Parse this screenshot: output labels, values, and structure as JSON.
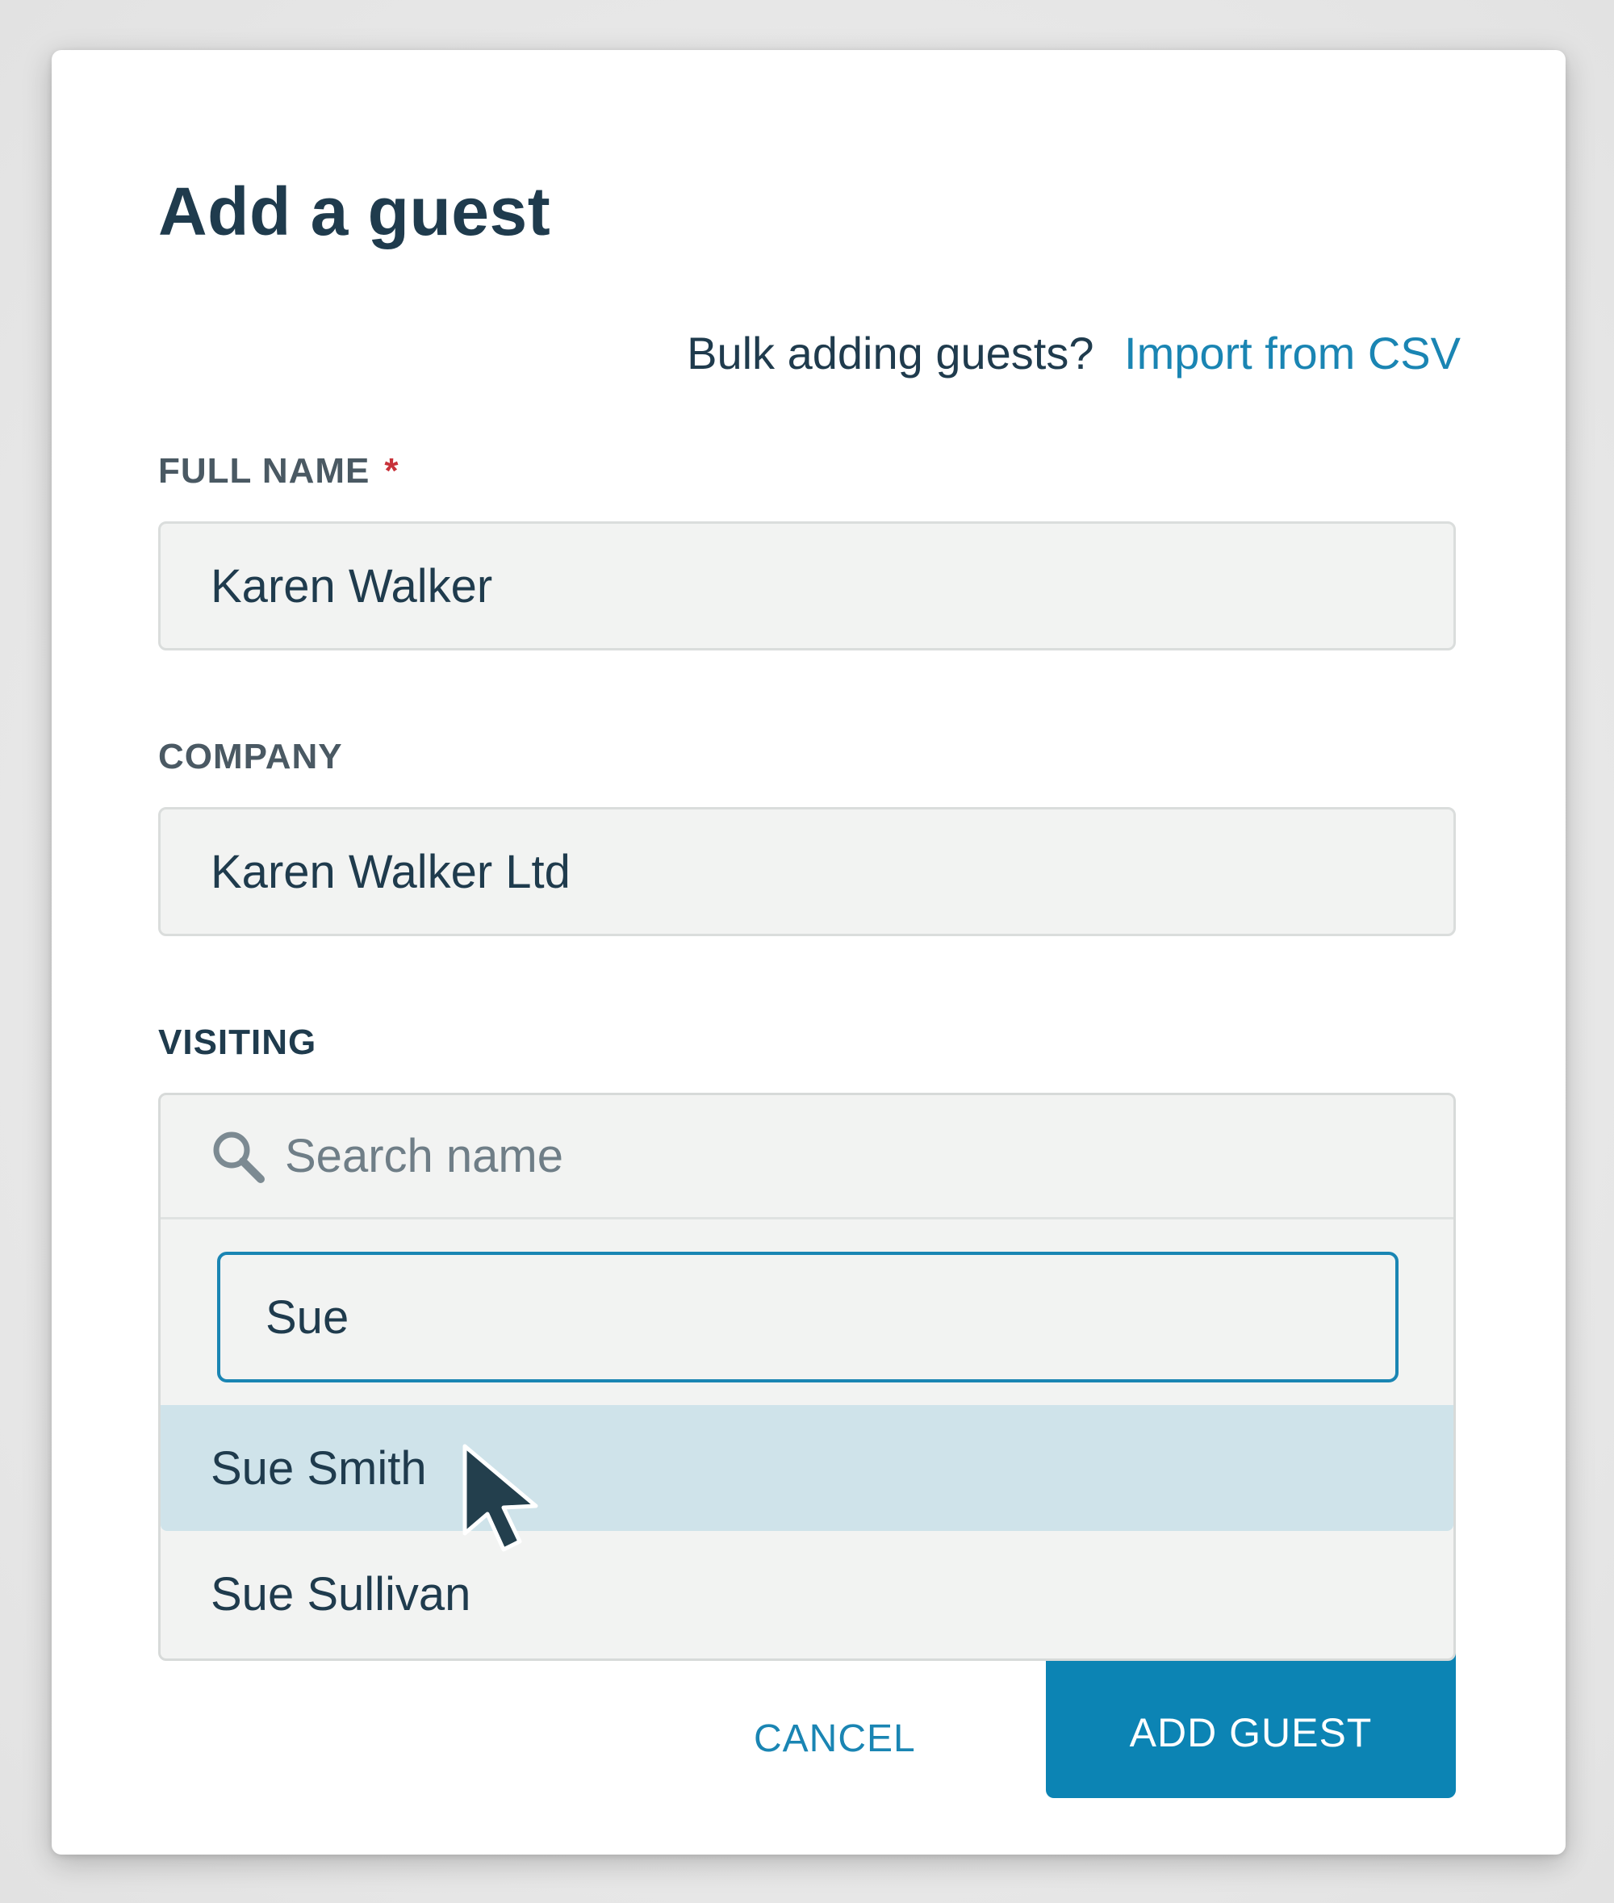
{
  "modal": {
    "title": "Add a guest"
  },
  "bulk": {
    "prompt": "Bulk adding guests?",
    "link_label": "Import from CSV"
  },
  "full_name": {
    "label": "FULL NAME",
    "required_mark": "*",
    "value": "Karen Walker"
  },
  "company": {
    "label": "COMPANY",
    "value": "Karen Walker Ltd"
  },
  "visiting": {
    "label": "VISITING",
    "search_placeholder": "Search name",
    "query": "Sue",
    "options": [
      {
        "label": "Sue Smith",
        "highlighted": true
      },
      {
        "label": "Sue Sullivan",
        "highlighted": false
      }
    ]
  },
  "actions": {
    "cancel_label": "CANCEL",
    "submit_label": "ADD GUEST"
  },
  "icons": {
    "search": "search-icon",
    "cursor": "mouse-pointer-icon"
  },
  "colors": {
    "accent": "#1a85b3",
    "primary_button": "#0c84b4",
    "text": "#1f3b4d",
    "required": "#c8323a",
    "highlight": "#cfe3ea"
  }
}
